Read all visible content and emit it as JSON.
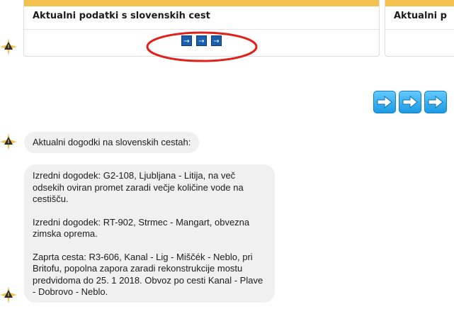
{
  "cards": [
    {
      "title": "Aktualni podatki s slovenskih cest",
      "buttons": [
        "→",
        "→",
        "→"
      ]
    },
    {
      "title": "Aktualni p"
    }
  ],
  "colors": {
    "card_accent": "#f2c14e",
    "arrow_blue": "#1a5fae",
    "bubble_bg": "#f1f0f0",
    "highlight": "#e0201b"
  },
  "carousel_nav": {
    "icons": [
      "arrow-right-icon",
      "arrow-right-icon",
      "arrow-right-icon"
    ]
  },
  "messages": [
    {
      "text": "Aktualni dogodki na slovenskih cestah:"
    },
    {
      "paragraphs": [
        "Izredni dogodek: G2-108, Ljubljana - Litija, na več odsekih oviran promet zaradi večje količine vode na cestišču.",
        "Izredni dogodek: RT-902, Strmec - Mangart, obvezna zimska oprema.",
        "Zaprta cesta: R3-606, Kanal - Lig - Miščék - Neblo, pri Britofu, popolna zapora zaradi rekonstrukcije mostu predvidoma do 25. 1 2018. Obvoz po cesti Kanal - Plave - Dobrovo - Neblo."
      ]
    }
  ]
}
